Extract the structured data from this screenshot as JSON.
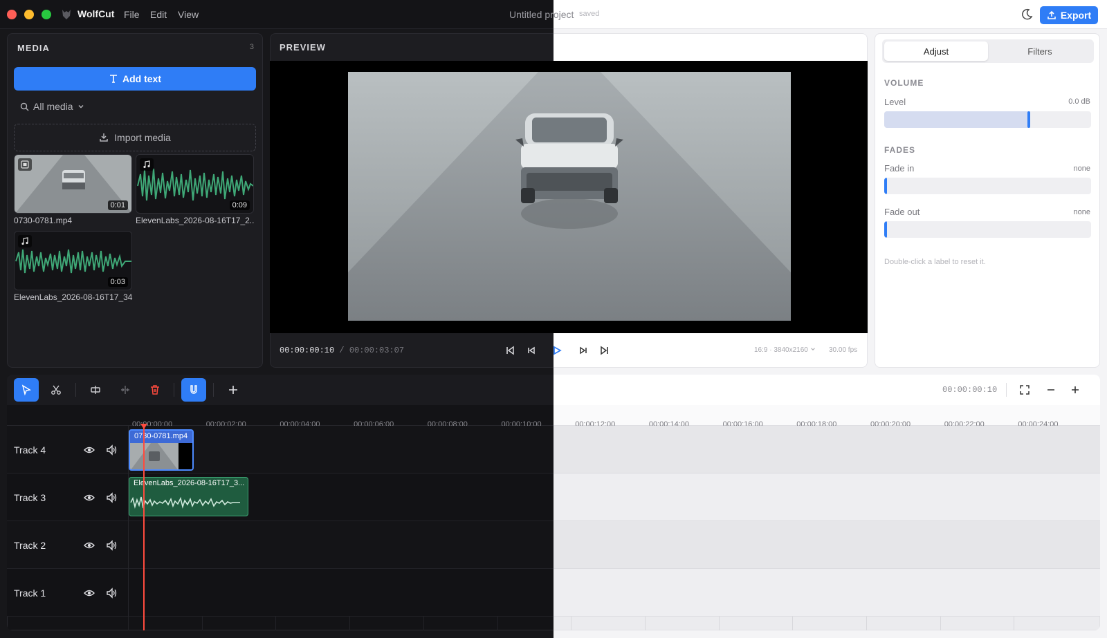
{
  "app": {
    "name": "WolfCut",
    "menus": [
      "File",
      "Edit",
      "View"
    ],
    "project_title_a": "Untitled pr",
    "project_title_b": "oject",
    "saved_label": "saved",
    "export_label": "Export"
  },
  "media": {
    "title": "MEDIA",
    "count": "3",
    "add_text_label": "Add text",
    "filter_label": "All media",
    "import_label": "Import media",
    "items": [
      {
        "name": "0730-0781.mp4",
        "duration": "0:01",
        "kind": "video"
      },
      {
        "name": "ElevenLabs_2026-08-16T17_2...",
        "duration": "0:09",
        "kind": "audio"
      },
      {
        "name": "ElevenLabs_2026-08-16T17_34...",
        "duration": "0:03",
        "kind": "audio"
      }
    ]
  },
  "preview": {
    "title": "PREVIEW",
    "current_time": "00:00:00:10",
    "separator": " / ",
    "total_time": "00:00:03:07",
    "resolution": "16:9 · 3840x2160",
    "fps": "30.00 fps"
  },
  "adjust": {
    "tabs": [
      "Adjust",
      "Filters"
    ],
    "volume": {
      "title": "VOLUME",
      "label": "Level",
      "value": "0.0 dB",
      "fill_fraction": 0.7
    },
    "fades": {
      "title": "FADES",
      "fade_in": {
        "label": "Fade in",
        "value": "none"
      },
      "fade_out": {
        "label": "Fade out",
        "value": "none"
      }
    },
    "hint": "Double-click a label to reset it."
  },
  "timeline": {
    "current_time": "00:00:00:10",
    "ruler": [
      "00:00:00:00",
      "00:00:02:00",
      "00:00:04:00",
      "00:00:06:00",
      "00:00:08:00",
      "00:00:10:00",
      "00:00:12:00",
      "00:00:14:00",
      "00:00:16:00",
      "00:00:18:00",
      "00:00:20:00",
      "00:00:22:00",
      "00:00:24:00"
    ],
    "tracks": [
      "Track 4",
      "Track 3",
      "Track 2",
      "Track 1"
    ],
    "clips": {
      "video": "0730-0781.mp4",
      "audio": "ElevenLabs_2026-08-16T17_3..."
    }
  },
  "colors": {
    "accent": "#2f7df6",
    "waveform": "#3fa877",
    "playhead": "#ff4b3e"
  }
}
